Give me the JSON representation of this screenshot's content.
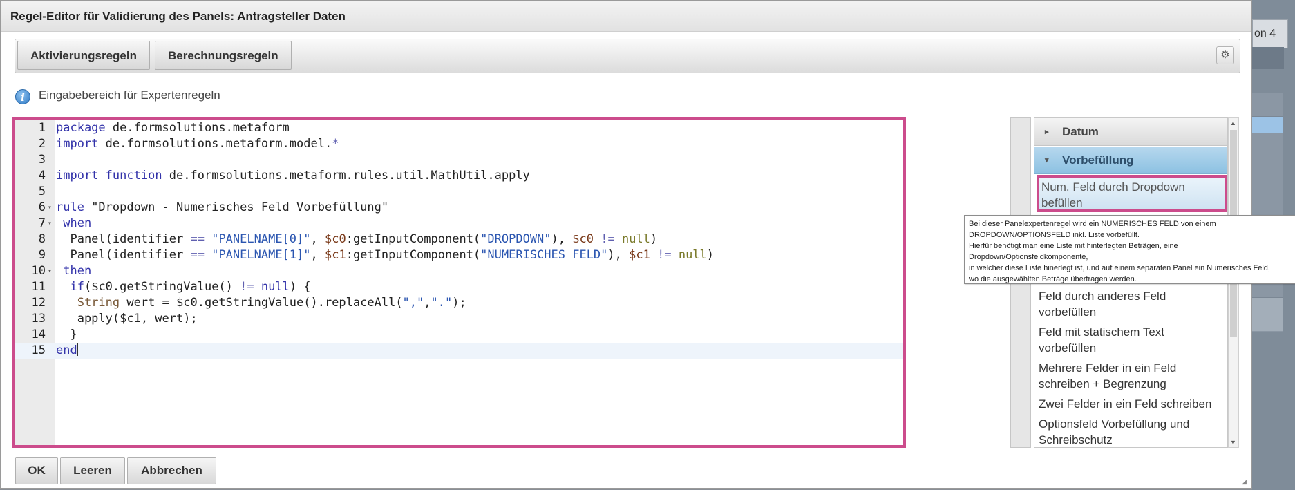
{
  "dialog": {
    "title": "Regel-Editor für Validierung des Panels: Antragsteller Daten"
  },
  "background": {
    "tab_fragment": "on 4"
  },
  "toolbar": {
    "activation_label": "Aktivierungsregeln",
    "calculation_label": "Berechnungsregeln",
    "settings_icon": "gear-icon"
  },
  "info": {
    "icon": "info-icon",
    "label": "Eingabebereich für Expertenregeln"
  },
  "editor": {
    "line_numbers": [
      "1",
      "2",
      "3",
      "4",
      "5",
      "6",
      "7",
      "8",
      "9",
      "10",
      "11",
      "12",
      "13",
      "14",
      "15"
    ],
    "active_line": 15
  },
  "rules_panel": {
    "sections": [
      {
        "label": "Datum",
        "state": "collapsed"
      },
      {
        "label": "Vorbefüllung",
        "state": "expanded"
      }
    ],
    "items": [
      "Num. Feld durch Dropdown befüllen",
      "Feld durch anderes Feld vorbefüllen",
      "Feld mit statischem Text vorbefüllen",
      "Mehrere Felder in ein Feld schreiben + Begrenzung",
      "Zwei Felder in ein Feld schreiben",
      "Optionsfeld Vorbefüllung und Schreibschutz"
    ],
    "selected_item": "Num. Feld durch Dropdown befüllen"
  },
  "tooltip": {
    "lines": [
      "Bei dieser Panelexpertenregel wird ein NUMERISCHES FELD von einem",
      "DROPDOWN/OPTIONSFELD inkl. Liste vorbefüllt.",
      "Hierfür benötigt man eine Liste mit hinterlegten Beträgen, eine",
      "Dropdown/Optionsfeldkomponente,",
      "in welcher diese Liste hinerlegt ist, und auf einem separaten Panel ein Numerisches Feld,",
      "wo die ausgewählten Beträge übertragen werden."
    ]
  },
  "footer": {
    "ok_label": "OK",
    "clear_label": "Leeren",
    "cancel_label": "Abbrechen"
  }
}
